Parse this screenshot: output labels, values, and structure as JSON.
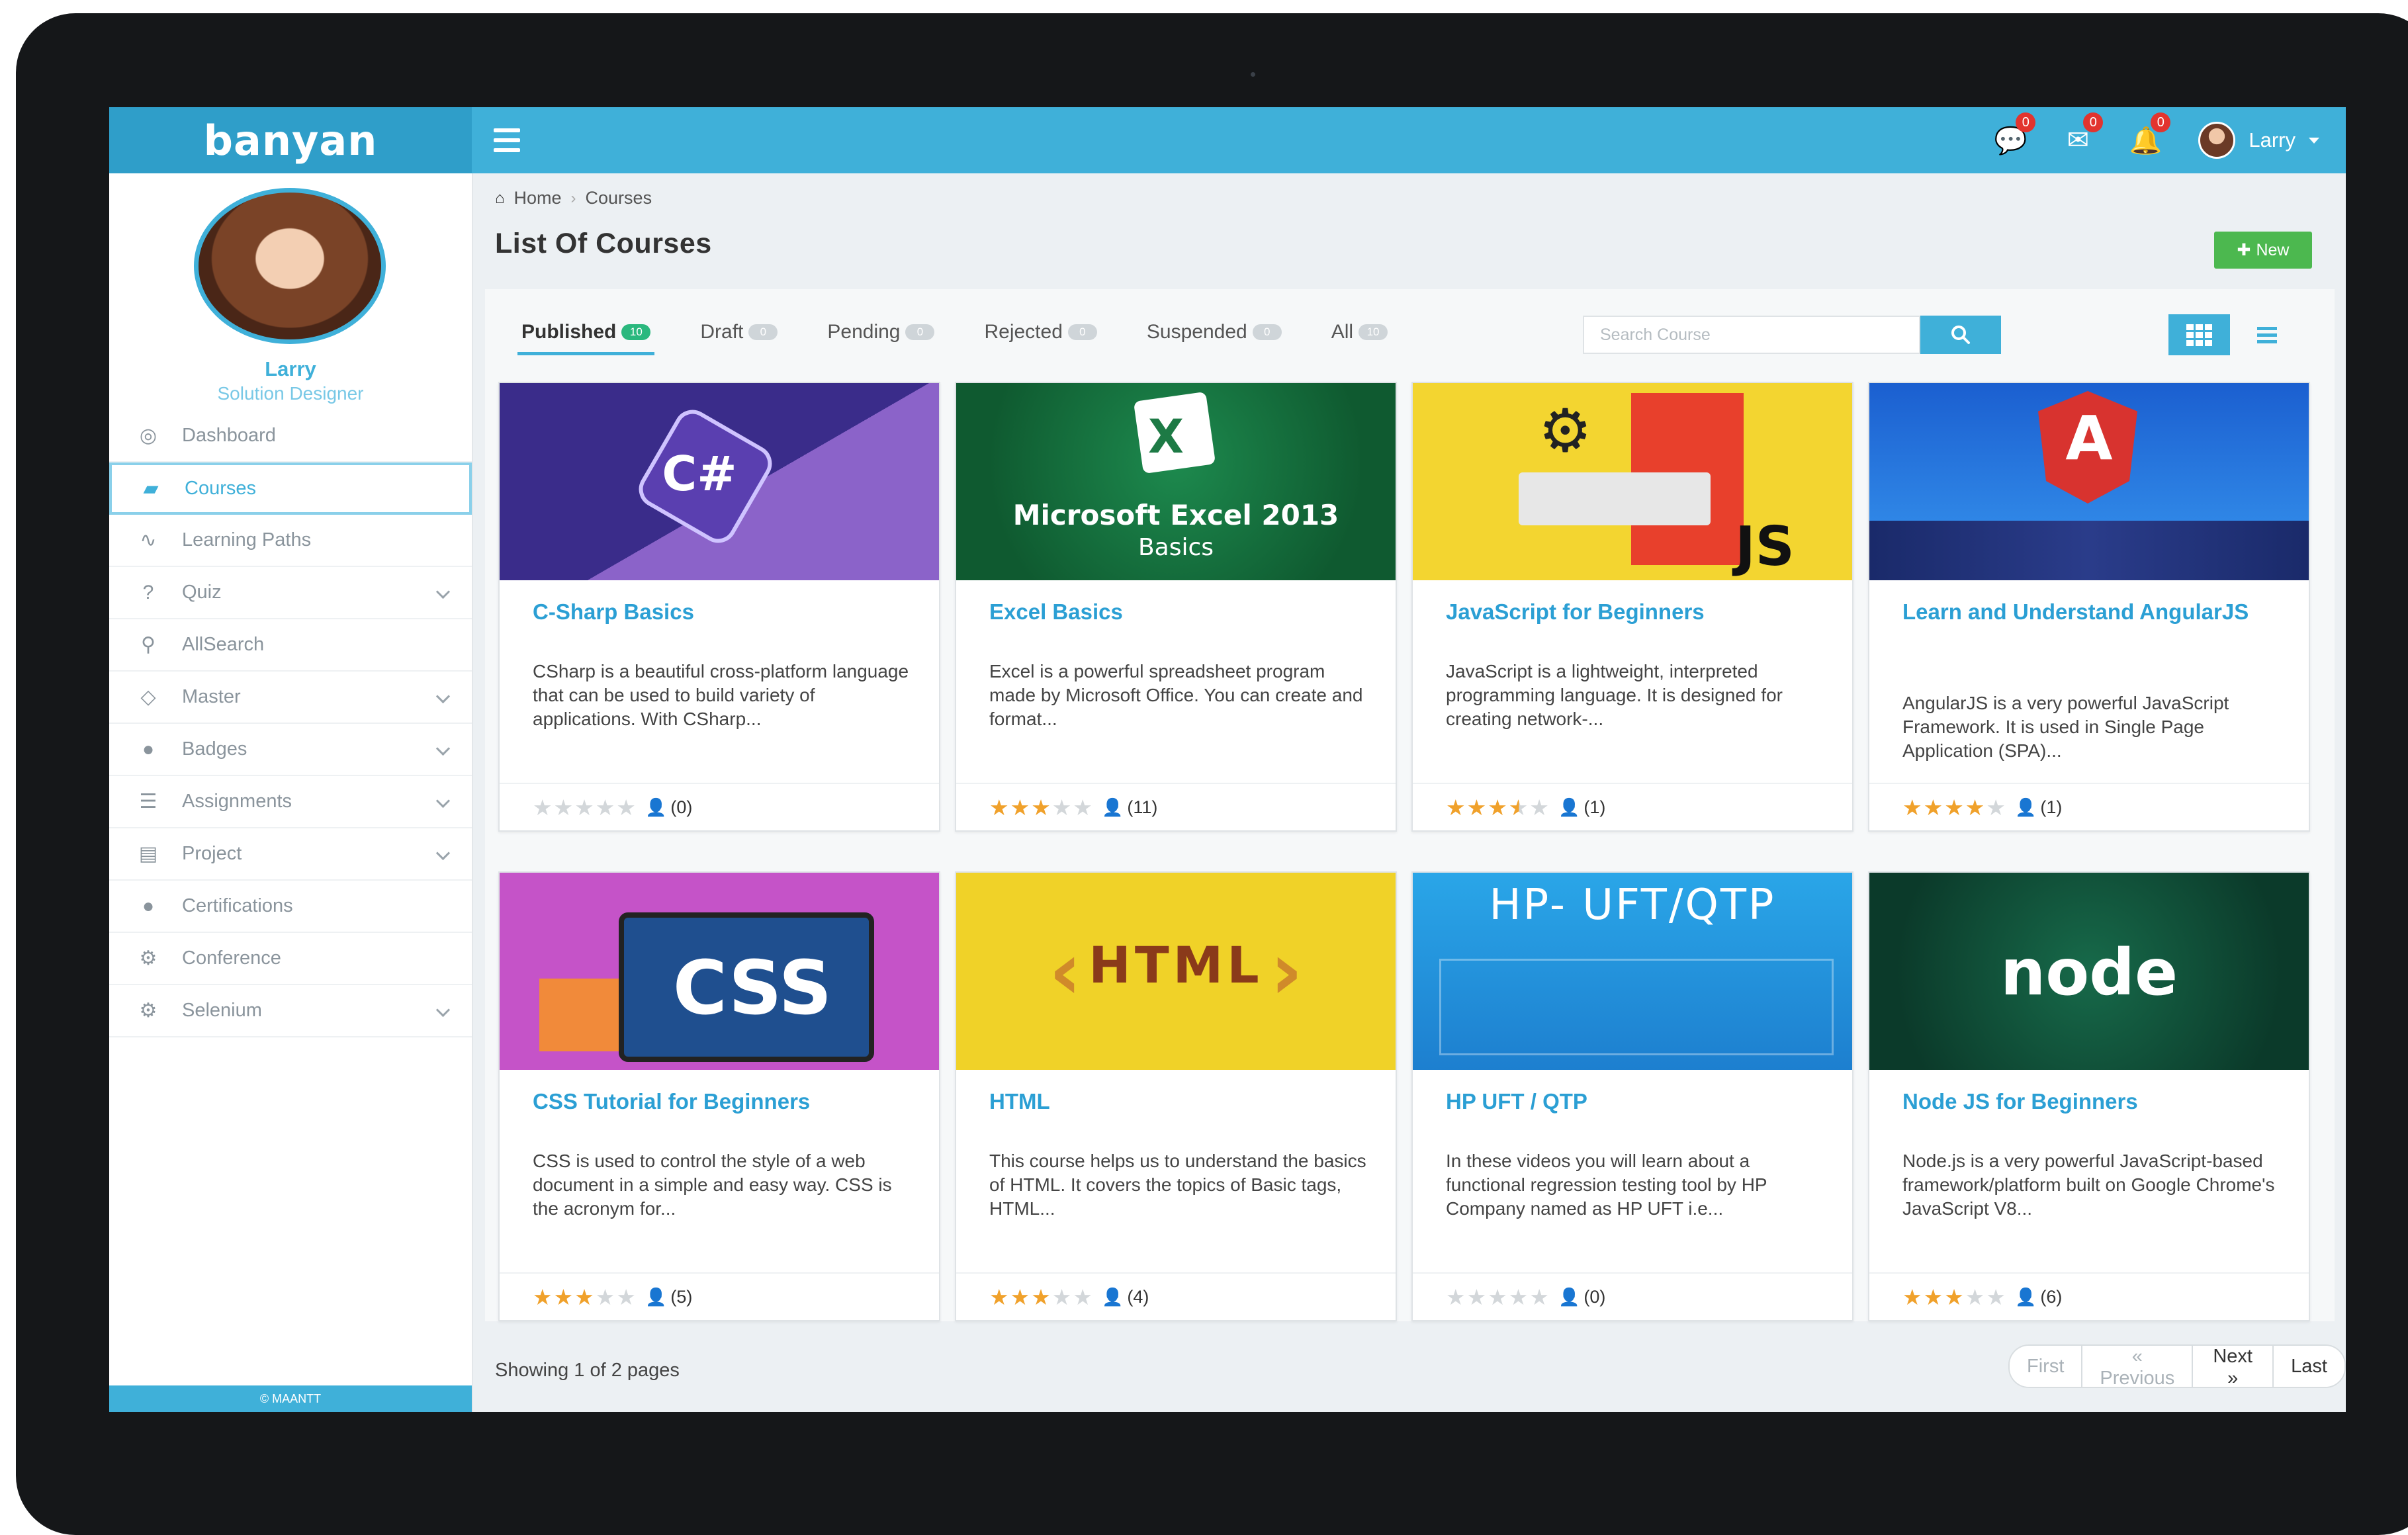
{
  "app": {
    "brand": "banyan",
    "footer": "© MAANTT"
  },
  "topbar": {
    "chat_badge": "0",
    "mail_badge": "0",
    "bell_badge": "0",
    "user": "Larry"
  },
  "sidebar": {
    "name": "Larry",
    "role": "Solution Designer",
    "items": [
      {
        "label": "Dashboard",
        "icon": "dashboard-icon",
        "glyph": "◎",
        "expandable": false,
        "active": false
      },
      {
        "label": "Courses",
        "icon": "book-icon",
        "glyph": "▰",
        "expandable": false,
        "active": true
      },
      {
        "label": "Learning Paths",
        "icon": "chart-line-icon",
        "glyph": "∿",
        "expandable": false,
        "active": false
      },
      {
        "label": "Quiz",
        "icon": "question-icon",
        "glyph": "?",
        "expandable": true,
        "active": false
      },
      {
        "label": "AllSearch",
        "icon": "search-icon",
        "glyph": "⚲",
        "expandable": false,
        "active": false
      },
      {
        "label": "Master",
        "icon": "diamond-icon",
        "glyph": "◇",
        "expandable": true,
        "active": false
      },
      {
        "label": "Badges",
        "icon": "badge-icon",
        "glyph": "●",
        "expandable": true,
        "active": false
      },
      {
        "label": "Assignments",
        "icon": "assignments-icon",
        "glyph": "☰",
        "expandable": true,
        "active": false
      },
      {
        "label": "Project",
        "icon": "project-icon",
        "glyph": "▤",
        "expandable": true,
        "active": false
      },
      {
        "label": "Certifications",
        "icon": "certificate-icon",
        "glyph": "●",
        "expandable": false,
        "active": false
      },
      {
        "label": "Conference",
        "icon": "conference-icon",
        "glyph": "⚙",
        "expandable": false,
        "active": false
      },
      {
        "label": "Selenium",
        "icon": "gear-icon",
        "glyph": "⚙",
        "expandable": true,
        "active": false
      }
    ]
  },
  "breadcrumb": {
    "home": "Home",
    "current": "Courses"
  },
  "page": {
    "title": "List Of Courses",
    "new_label": "New"
  },
  "tabs": [
    {
      "label": "Published",
      "count": "10",
      "active": true
    },
    {
      "label": "Draft",
      "count": "0",
      "active": false
    },
    {
      "label": "Pending",
      "count": "0",
      "active": false
    },
    {
      "label": "Rejected",
      "count": "0",
      "active": false
    },
    {
      "label": "Suspended",
      "count": "0",
      "active": false
    },
    {
      "label": "All",
      "count": "10",
      "active": false
    }
  ],
  "search": {
    "placeholder": "Search Course",
    "value": ""
  },
  "courses": [
    {
      "title": "C-Sharp Basics",
      "desc": "CSharp is a beautiful cross-platform language that can be used to build variety of applications. With CSharp...",
      "rating": 0,
      "count": "(0)",
      "thumb": "csharp",
      "thumb_text": "C#"
    },
    {
      "title": "Excel Basics",
      "desc": "Excel is a powerful spreadsheet program made by Microsoft Office. You can create and format...",
      "rating": 3,
      "count": "(11)",
      "thumb": "excel",
      "thumb_text": "Microsoft Excel 2013",
      "thumb_sub": "Basics"
    },
    {
      "title": "JavaScript for Beginners",
      "desc": "JavaScript is a lightweight, interpreted programming language. It is designed for creating network-...",
      "rating": 3.5,
      "count": "(1)",
      "thumb": "js",
      "thumb_text": "JS"
    },
    {
      "title": "Learn and Understand AngularJS",
      "desc": "AngularJS is a very powerful JavaScript Framework. It is used in Single Page Application (SPA)...",
      "rating": 4,
      "count": "(1)",
      "thumb": "angular",
      "thumb_text": "A"
    },
    {
      "title": "CSS Tutorial for Beginners",
      "desc": "CSS is used to control the style of a web document in a simple and easy way. CSS is the acronym for...",
      "rating": 3,
      "count": "(5)",
      "thumb": "css",
      "thumb_text": "CSS"
    },
    {
      "title": "HTML",
      "desc": "This course helps us to understand the basics of HTML. It covers the topics of Basic tags, HTML...",
      "rating": 3,
      "count": "(4)",
      "thumb": "html",
      "thumb_text": "HTML"
    },
    {
      "title": "HP UFT / QTP",
      "desc": "In these videos you will learn about a functional regression testing tool by HP Company named as HP UFT i.e...",
      "rating": 0,
      "count": "(0)",
      "thumb": "hp",
      "thumb_text": "HP- UFT/QTP"
    },
    {
      "title": "Node JS for Beginners",
      "desc": "Node.js is a very powerful JavaScript-based framework/platform built on Google Chrome's JavaScript V8...",
      "rating": 3,
      "count": "(6)",
      "thumb": "node",
      "thumb_text": "node"
    }
  ],
  "pagination": {
    "showing": "Showing 1 of 2 pages",
    "first": "First",
    "previous": "« Previous",
    "next": "Next »",
    "last": "Last"
  },
  "colors": {
    "accent": "#3fb0d9",
    "star": "#f0a12b",
    "new_button": "#4cb84f",
    "badge": "#e2342f"
  }
}
